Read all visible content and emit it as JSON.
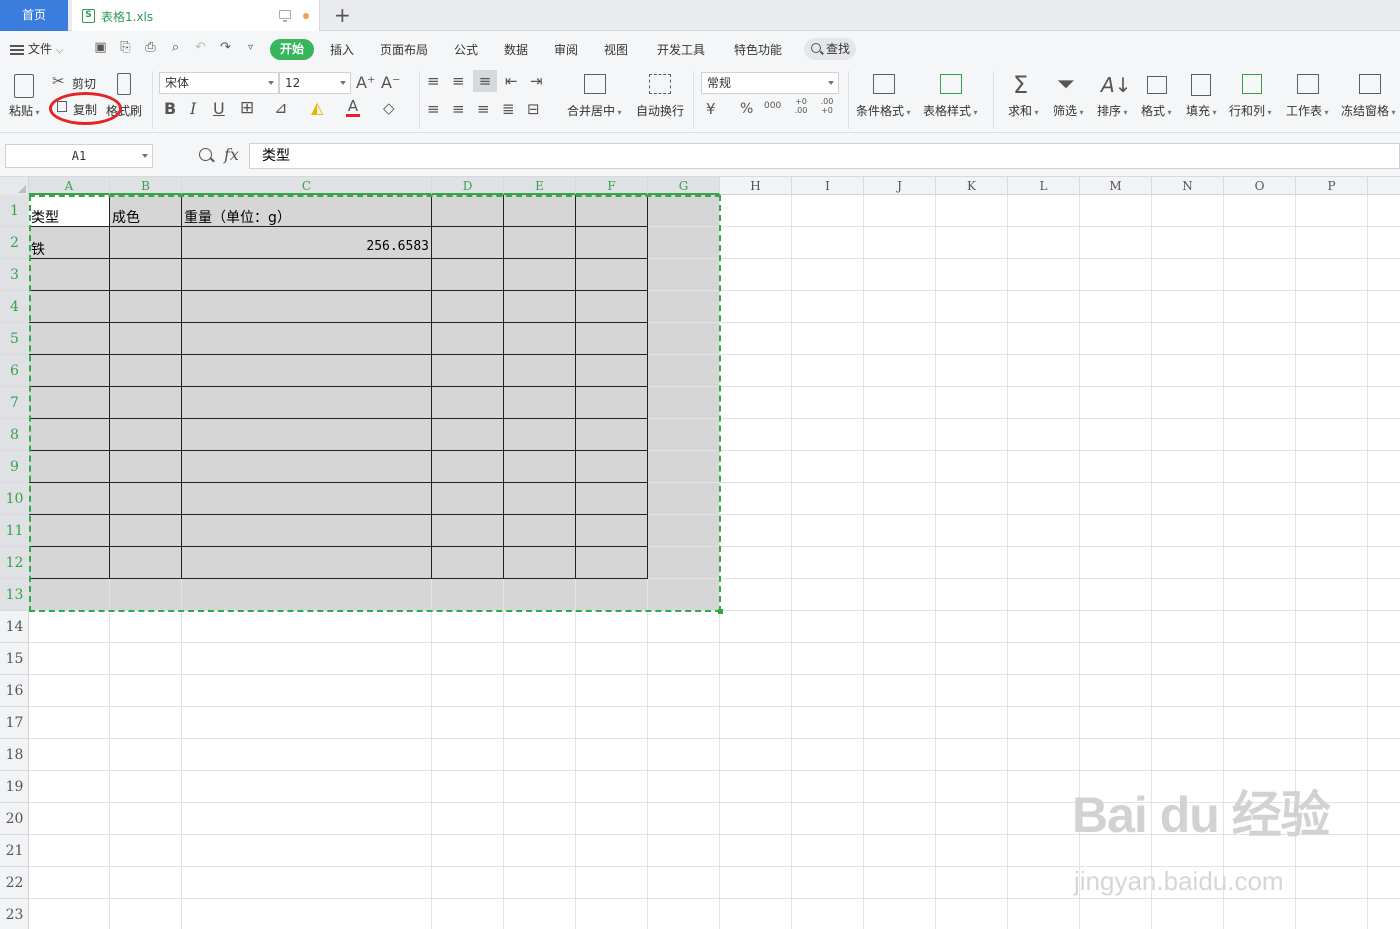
{
  "tabs": {
    "home": "首页",
    "document": "表格1.xls",
    "add_label": "+"
  },
  "menu": {
    "file": "文件",
    "items": [
      "开始",
      "插入",
      "页面布局",
      "公式",
      "数据",
      "审阅",
      "视图",
      "开发工具",
      "特色功能"
    ],
    "active": "开始",
    "search": "查找"
  },
  "ribbon": {
    "paste": "粘贴",
    "cut": "剪切",
    "copy": "复制",
    "format_painter": "格式刷",
    "font_name": "宋体",
    "font_size": "12",
    "bold": "B",
    "italic": "I",
    "underline": "U",
    "merge_center": "合并居中",
    "wrap_text": "自动换行",
    "number_format": "常规",
    "currency": "¥",
    "percent": "%",
    "thousands": "000",
    "dec_inc": "+0 .00",
    "dec_dec": ".00 +0",
    "conditional_format": "条件格式",
    "table_style": "表格样式",
    "sum": "求和",
    "filter": "筛选",
    "sort": "排序",
    "format": "格式",
    "fill": "填充",
    "row_col": "行和列",
    "worksheet": "工作表",
    "freeze": "冻结窗格",
    "font_color_label": "A"
  },
  "formula_bar": {
    "cell_ref": "A1",
    "fx": "fx",
    "value": "类型"
  },
  "sheet": {
    "columns": [
      "A",
      "B",
      "C",
      "D",
      "E",
      "F",
      "G",
      "H",
      "I",
      "J",
      "K",
      "L",
      "M",
      "N",
      "O",
      "P"
    ],
    "rows": [
      "1",
      "2",
      "3",
      "4",
      "5",
      "6",
      "7",
      "8",
      "9",
      "10",
      "11",
      "12",
      "13",
      "14",
      "15",
      "16",
      "17",
      "18",
      "19",
      "20",
      "21",
      "22",
      "23"
    ],
    "cells": {
      "A1": "类型",
      "B1": "成色",
      "C1": "重量（单位：g）",
      "A2": "铁",
      "C2": "256.6583"
    }
  },
  "watermark": {
    "brand": "Bai du 经验",
    "url": "jingyan.baidu.com"
  },
  "colors": {
    "accent_green": "#36b55b",
    "home_tab_blue": "#3b7ddd",
    "selection_dash": "#2eab48",
    "annotation_red": "#e32525"
  }
}
